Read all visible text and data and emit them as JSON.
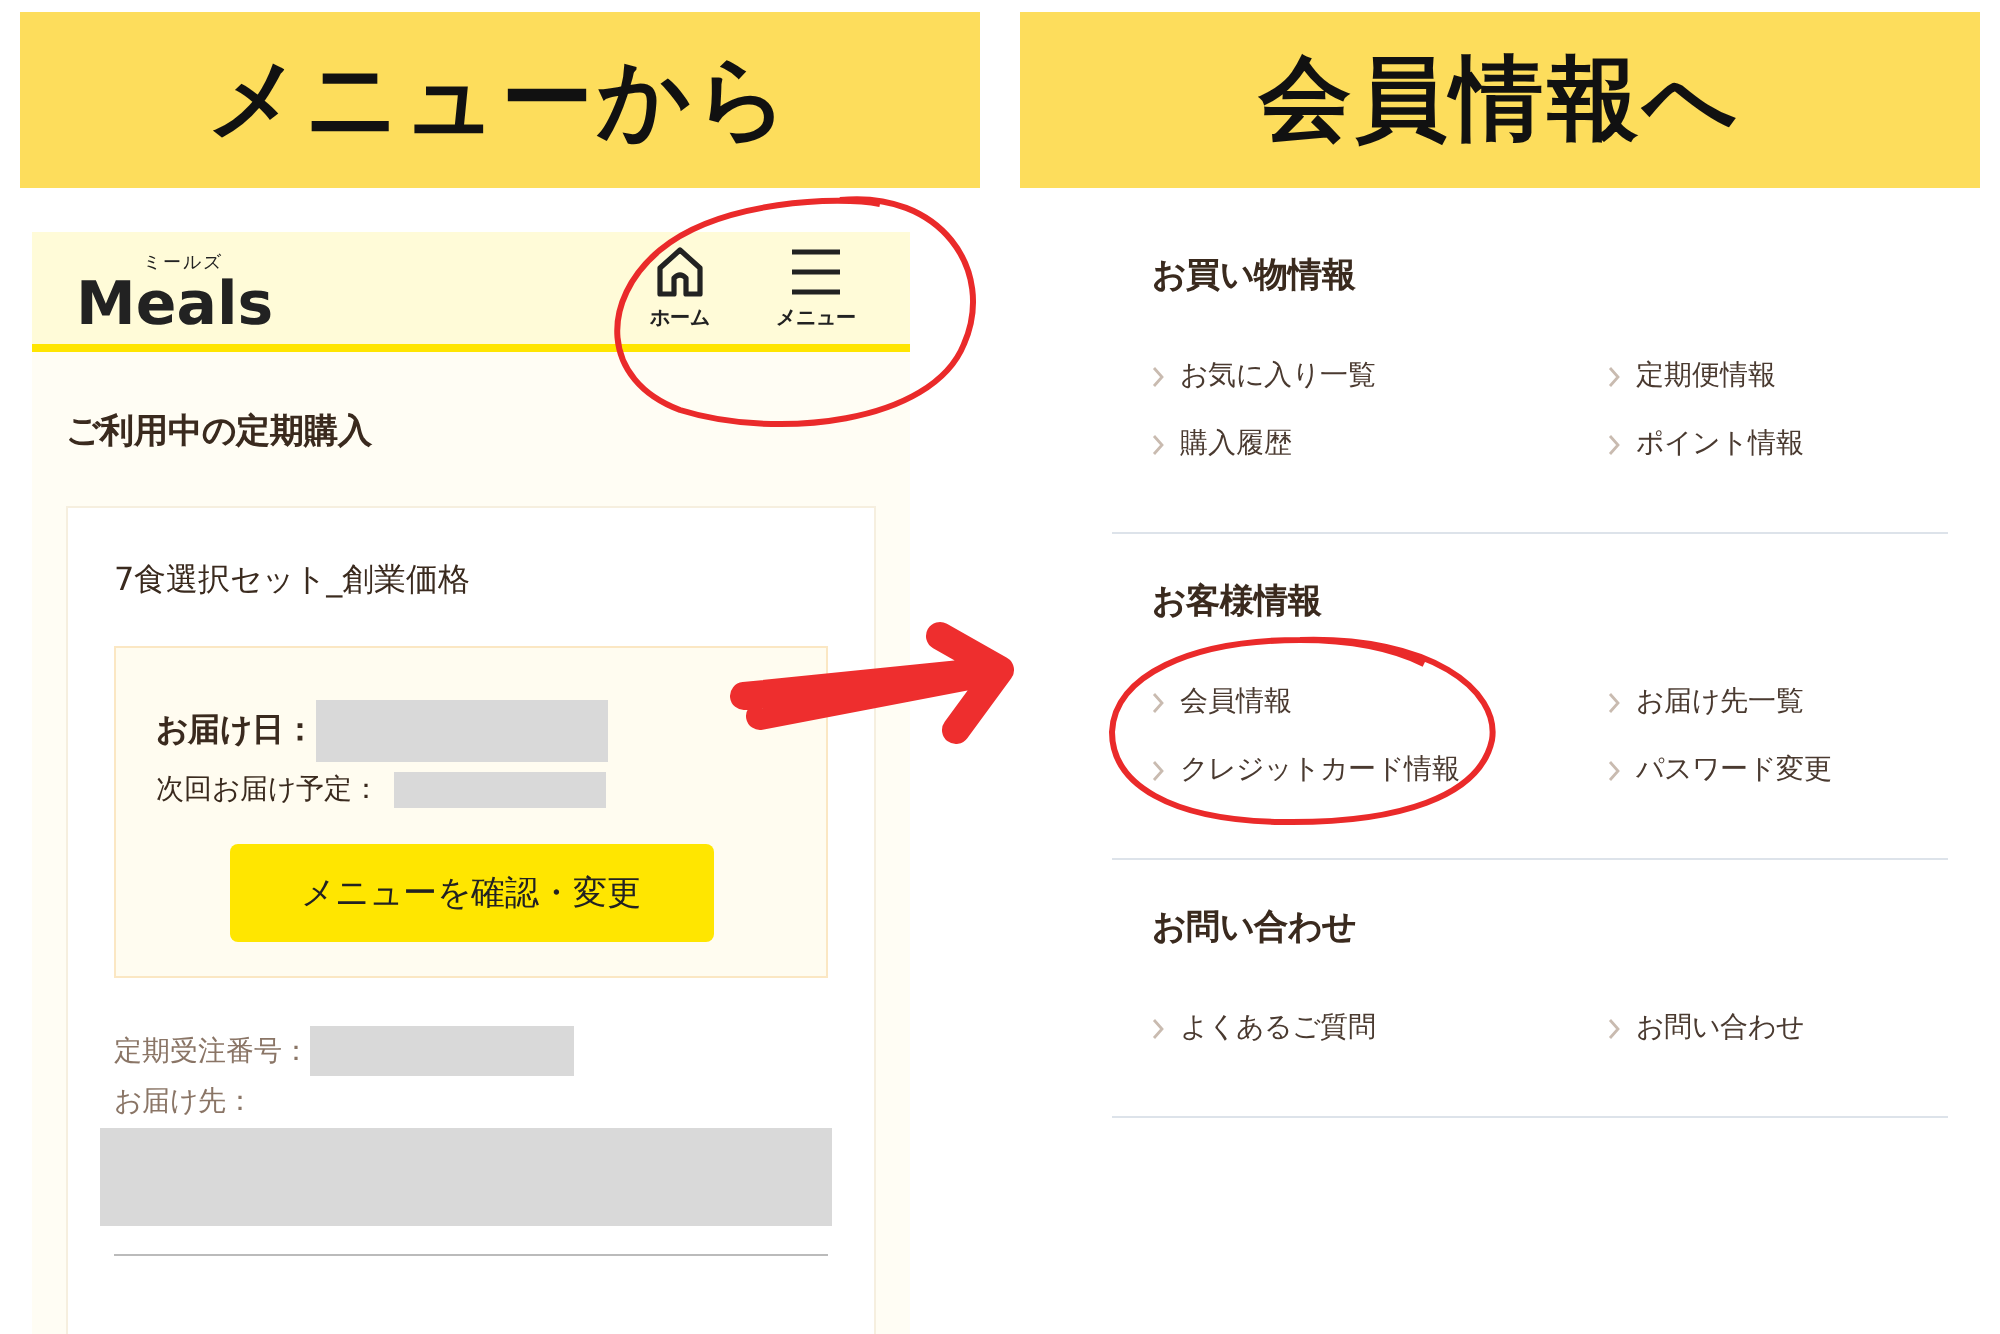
{
  "banners": [
    {
      "title": "メニューから"
    },
    {
      "title": "会員情報へ"
    }
  ],
  "app_header": {
    "logo_ruby": "ミールズ",
    "logo": "Meals",
    "nav": [
      {
        "label": "ホーム",
        "kind": "home"
      },
      {
        "label": "メニュー",
        "kind": "menu"
      }
    ]
  },
  "subscription": {
    "heading": "ご利用中の定期購入",
    "plan_name": "7食選択セット_創業価格",
    "delivery_date_label": "お届け日：",
    "next_delivery_label": "次回お届け予定：",
    "button": "メニューを確認・変更",
    "order_number_label": "定期受注番号：",
    "address_label": "お届け先："
  },
  "menu_sections": [
    {
      "title": "お買い物情報",
      "links": [
        "お気に入り一覧",
        "定期便情報",
        "購入履歴",
        "ポイント情報"
      ]
    },
    {
      "title": "お客様情報",
      "links": [
        "会員情報",
        "お届け先一覧",
        "クレジットカード情報",
        "パスワード変更"
      ]
    },
    {
      "title": "お問い合わせ",
      "links": [
        "よくあるご質問",
        "お問い合わせ"
      ]
    }
  ]
}
